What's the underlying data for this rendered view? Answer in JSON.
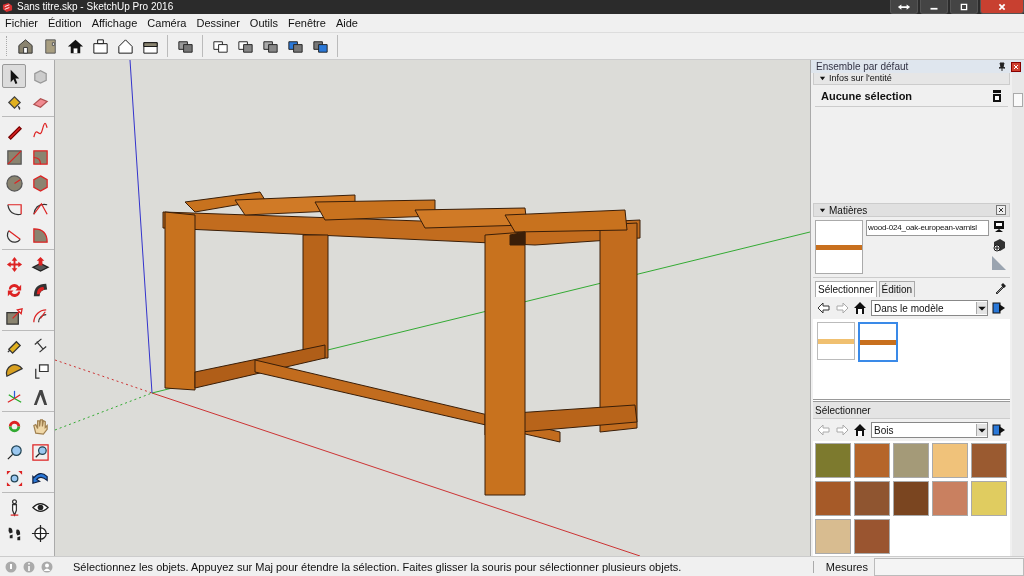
{
  "window": {
    "title": "Sans titre.skp - SketchUp Pro 2016"
  },
  "menu": [
    "Fichier",
    "Édition",
    "Affichage",
    "Caméra",
    "Dessiner",
    "Outils",
    "Fenêtre",
    "Aide"
  ],
  "tray": {
    "title": "Ensemble par défaut",
    "entity_info": {
      "title": "Infos sur l'entité",
      "selection": "Aucune sélection"
    },
    "materials": {
      "title": "Matières",
      "current_name": "wood-024_oak-european-varnisl",
      "tabs": [
        {
          "label": "Sélectionner",
          "selected": true
        },
        {
          "label": "Édition",
          "selected": false
        }
      ],
      "collection": "Dans le modèle",
      "model_materials": [
        {
          "color": "#f0c070",
          "selected": false
        },
        {
          "color": "#c8701e",
          "selected": true
        }
      ],
      "secondary": {
        "title": "Sélectionner",
        "collection": "Bois",
        "swatches": [
          {
            "color": "#7d7a2e"
          },
          {
            "color": "#b5652a"
          },
          {
            "color": "#a49a78"
          },
          {
            "color": "#f0c27a"
          },
          {
            "color": "#9a5a30"
          },
          {
            "color": "#a65a28"
          },
          {
            "color": "#8f5530"
          },
          {
            "color": "#7a4520"
          },
          {
            "color": "#c98060"
          },
          {
            "color": "#e0cc60"
          },
          {
            "color": "#d8bc90"
          },
          {
            "color": "#9a5530"
          }
        ]
      }
    }
  },
  "status_bar": {
    "message": "Sélectionnez les objets. Appuyez sur Maj pour étendre la sélection. Faites glisser la souris pour sélectionner plusieurs objets.",
    "measurements_label": "Mesures"
  }
}
